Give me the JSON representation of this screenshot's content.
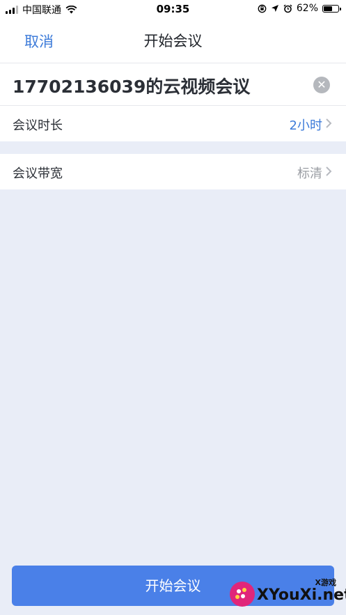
{
  "status_bar": {
    "carrier": "中国联通",
    "time": "09:35",
    "battery_percent": "62%",
    "battery_level": 0.62
  },
  "nav": {
    "cancel_label": "取消",
    "title": "开始会议"
  },
  "meeting": {
    "name": "17702136039的云视频会议",
    "settings": [
      {
        "label": "会议时长",
        "value": "2小时",
        "value_color": "#3d7bd9"
      },
      {
        "label": "会议带宽",
        "value": "标清",
        "value_color": "#9a9da3"
      }
    ]
  },
  "start_button_label": "开始会议",
  "watermark": {
    "text": "XYouXi.net",
    "small": "X游戏"
  },
  "colors": {
    "accent": "#3d7bd9",
    "button": "#4a80e8",
    "background": "#e9edf7"
  }
}
